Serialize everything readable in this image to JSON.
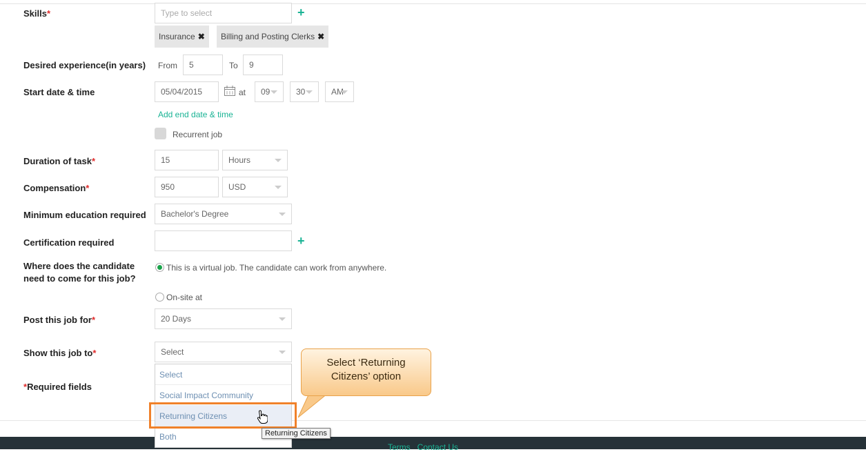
{
  "form": {
    "skills": {
      "label": "Skills",
      "required_mark": "*",
      "placeholder": "Type to select",
      "tags": [
        "Insurance",
        "Billing and Posting Clerks"
      ],
      "remove_glyph": "✖"
    },
    "experience": {
      "label": "Desired experience(in years)",
      "from_label": "From",
      "from_value": "5",
      "to_label": "To",
      "to_value": "9"
    },
    "start": {
      "label": "Start date & time",
      "date": "05/04/2015",
      "at_label": "at",
      "hour": "09",
      "minute": "30",
      "ampm": "AM",
      "add_end_link": "Add end date & time",
      "recurrent_label": "Recurrent job"
    },
    "duration": {
      "label": "Duration of task",
      "required_mark": "*",
      "value": "15",
      "unit": "Hours"
    },
    "compensation": {
      "label": "Compensation",
      "required_mark": "*",
      "value": "950",
      "currency": "USD"
    },
    "education": {
      "label": "Minimum education required",
      "value": "Bachelor's Degree"
    },
    "certification": {
      "label": "Certification required",
      "value": ""
    },
    "location": {
      "label_line1": "Where does the candidate",
      "label_line2": "need to come for this job?",
      "option_virtual": "This is a virtual job. The candidate can work from anywhere.",
      "option_onsite": "On-site at"
    },
    "post_for": {
      "label": "Post this job for",
      "required_mark": "*",
      "value": "20 Days"
    },
    "show_to": {
      "label": "Show this job to",
      "required_mark": "*",
      "value": "Select",
      "options": [
        "Select",
        "Social Impact Community",
        "Returning Citizens",
        "Both"
      ],
      "highlighted": "Returning Citizens"
    },
    "required_note": {
      "mark": "*",
      "text": "Required fields"
    }
  },
  "tooltip": "Returning Citizens",
  "callout": {
    "line1": "Select ‘Returning",
    "line2": "Citizens’ option"
  },
  "footer": {
    "links": [
      "Terms",
      "Contact Us"
    ]
  },
  "colors": {
    "accent": "#19b394",
    "required": "#e02b2b",
    "highlight": "#f0812a"
  }
}
